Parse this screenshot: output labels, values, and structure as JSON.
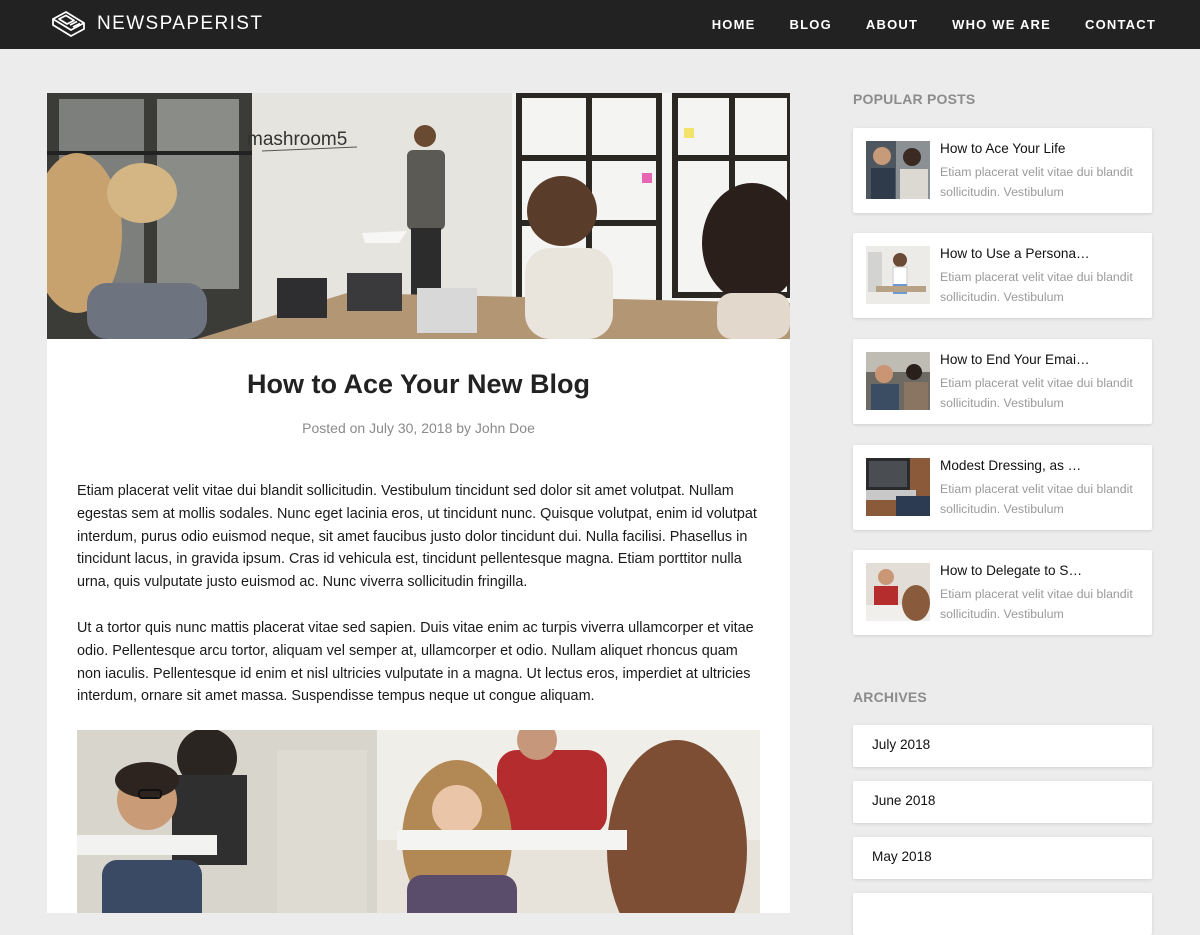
{
  "site": {
    "name": "NEWSPAPERIST",
    "logo_icon": "newspaper-icon"
  },
  "nav": {
    "items": [
      "HOME",
      "BLOG",
      "ABOUT",
      "WHO WE ARE",
      "CONTACT"
    ]
  },
  "article": {
    "title": "How to Ace Your New Blog",
    "meta": "Posted on July 30, 2018 by John Doe",
    "hero_image_text": "mashroom5",
    "paragraphs": [
      "Etiam placerat velit vitae dui blandit sollicitudin. Vestibulum tincidunt sed dolor sit amet volutpat. Nullam egestas sem at mollis sodales. Nunc eget lacinia eros, ut tincidunt nunc. Quisque volutpat, enim id volutpat interdum, purus odio euismod neque, sit amet faucibus justo dolor tincidunt dui. Nulla facilisi. Phasellus in tincidunt lacus, in gravida ipsum. Cras id vehicula est, tincidunt pellentesque magna. Etiam porttitor nulla urna, quis vulputate justo euismod ac. Nunc viverra sollicitudin fringilla.",
      "Ut a tortor quis nunc mattis placerat vitae sed sapien. Duis vitae enim ac turpis viverra ullamcorper et vitae odio. Pellentesque arcu tortor, aliquam vel semper at, ullamcorper et odio. Nullam aliquet rhoncus quam non iaculis. Pellentesque id enim et nisl ultricies vulputate in a magna. Ut lectus eros, imperdiet at ultricies interdum, ornare sit amet massa. Suspendisse tempus neque ut congue aliquam."
    ]
  },
  "sidebar": {
    "popular_heading": "POPULAR POSTS",
    "popular_posts": [
      {
        "title": "How to Ace Your Life",
        "excerpt": "Etiam placerat velit vitae dui blandit sollicitudin. Vestibulum"
      },
      {
        "title": "How to Use a Persona…",
        "excerpt": "Etiam placerat velit vitae dui blandit sollicitudin. Vestibulum"
      },
      {
        "title": "How to End Your Emai…",
        "excerpt": "Etiam placerat velit vitae dui blandit sollicitudin. Vestibulum"
      },
      {
        "title": "Modest Dressing, as …",
        "excerpt": "Etiam placerat velit vitae dui blandit sollicitudin. Vestibulum"
      },
      {
        "title": "How to Delegate to S…",
        "excerpt": "Etiam placerat velit vitae dui blandit sollicitudin. Vestibulum"
      }
    ],
    "archives_heading": "ARCHIVES",
    "archives": [
      "July 2018",
      "June 2018",
      "May 2018"
    ]
  },
  "colors": {
    "header_bg": "#222222",
    "page_bg": "#ececec",
    "meta_text": "#8a8a8a",
    "sidebar_heading": "#8c8c8c"
  }
}
